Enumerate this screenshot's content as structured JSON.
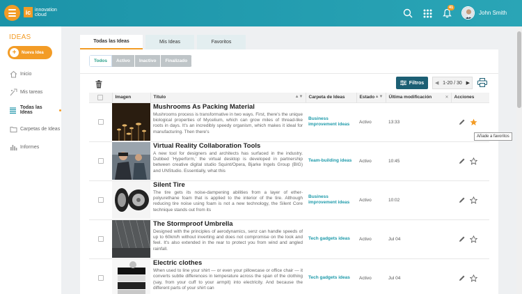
{
  "header": {
    "logo_mark": "ic",
    "logo_line1": "innovation",
    "logo_line2": "cloud",
    "notification_count": "41",
    "user_name": "John Smith"
  },
  "sidebar": {
    "title": "IDEAS",
    "new_idea_label": "Nueva Idea",
    "items": [
      {
        "label": "Inicio",
        "icon": "home-icon"
      },
      {
        "label": "Mis tareas",
        "icon": "tasks-icon"
      },
      {
        "label": "Todas las Ideas",
        "icon": "list-icon",
        "active": true
      },
      {
        "label": "Carpetas de Ideas",
        "icon": "folder-icon"
      },
      {
        "label": "Informes",
        "icon": "chart-icon"
      }
    ]
  },
  "tabs": [
    "Todas las Ideas",
    "Mis Ideas",
    "Favoritos"
  ],
  "filters": [
    "Todos",
    "Activo",
    "Inactivo",
    "Finalizado"
  ],
  "toolbar": {
    "filtros_label": "Filtros",
    "pager_text": "1-20 / 30"
  },
  "table": {
    "columns": [
      "Imagen",
      "Título",
      "Carpeta de Ideas",
      "Estado",
      "Última modificación",
      "Acciones"
    ],
    "rows": [
      {
        "title": "Mushrooms As Packing Material",
        "desc": "Mushrooms process is transformative in two ways. First, there's the unique biological properties of Mycelium, which can grow miles of thread-like roots in days. It's an incredibly speedy organism, which makes it ideal for manufacturing. Then there's",
        "folder": "Business improvement ideas",
        "status": "Activo",
        "modified": "13:33",
        "favorite": true
      },
      {
        "title": "Virtual Reality Collaboration Tools",
        "desc": "A new tool for designers and architects has surfaced in the industry. Dubbed 'Hyperform,' the virtual desktop is developed in partnership between creative digital studio Squint/Opera, Bjarke Ingels Group (BIG) and UNStudio. Essentially, what this",
        "folder": "Team-building ideas",
        "status": "Activo",
        "modified": "10:45",
        "favorite": false
      },
      {
        "title": "Silent Tire",
        "desc": "The tire gets its noise-dampening abilities from a layer of ether-polyurethane foam that is applied to the interior of the tire. Although reducing tire noise using foam is not a new technology, the Silent Core technique stands out from its",
        "folder": "Business improvement ideas",
        "status": "Activo",
        "modified": "10:02",
        "favorite": false
      },
      {
        "title": "The Stormproof Umbrella",
        "desc": "Designed with the principles of aerodynamics, senz can handle speeds of up to 60km/h without inverting and does not compromise on the look and feel. It's also extended in the rear to protect you from wind and angled rainfall.",
        "folder": "Tech gadgets ideas",
        "status": "Activo",
        "modified": "Jul 04",
        "favorite": false
      },
      {
        "title": "Electric clothes",
        "desc": "When used to line your shirt — or even your pillowcase or office chair — it converts subtle differences in temperature across the span of the clothing (say, from your cuff to your armpit) into electricity. And because the different parts of your shirt can",
        "folder": "Tech gadgets ideas",
        "status": "Activo",
        "modified": "Jul 04",
        "favorite": false
      }
    ]
  },
  "tooltip": "Añade a favoritos",
  "colors": {
    "topbar": "#1b93a8",
    "accent": "#f39c26",
    "filtros_button": "#1c5f74",
    "folder_link": "#1d9aaa"
  }
}
